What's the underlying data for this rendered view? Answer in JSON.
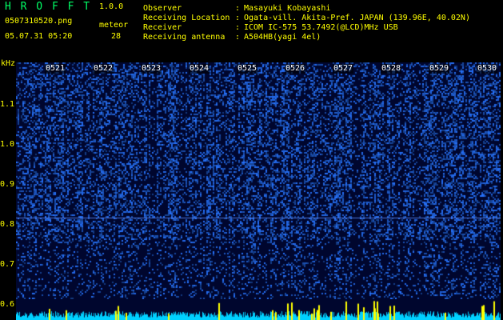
{
  "header": {
    "title": "H R O F F T",
    "version": "1.0.0",
    "filename": "0507310520.png",
    "meteor_label": "meteor",
    "datetime": "05.07.31 05:20",
    "meteor_count": "28"
  },
  "info": [
    {
      "label": "Observer",
      "value": "Masayuki Kobayashi"
    },
    {
      "label": "Receiving Location",
      "value": "Ogata-vill. Akita-Pref. JAPAN (139.96E, 40.02N)"
    },
    {
      "label": "Receiver",
      "value": "ICOM IC-575 53.7492(@LCD)MHz USB"
    },
    {
      "label": "Receiving antenna",
      "value": "A504HB(yagi 4el)"
    }
  ],
  "colors": {
    "header_text": "#ffff00",
    "title_text": "#00ff66",
    "background": "#00062e",
    "signal": "#2f6dff",
    "bottom_trace": "#00d0ff",
    "bottom_peak": "#ffff00"
  },
  "axis": {
    "unit": "kHz",
    "y_ticks": [
      "1.1",
      "1.0",
      "0.9",
      "0.8",
      "0.7",
      "0.6"
    ]
  },
  "time_labels": [
    "0521",
    "0522",
    "0523",
    "0524",
    "0525",
    "0526",
    "0527",
    "0528",
    "0529",
    "0530"
  ]
}
